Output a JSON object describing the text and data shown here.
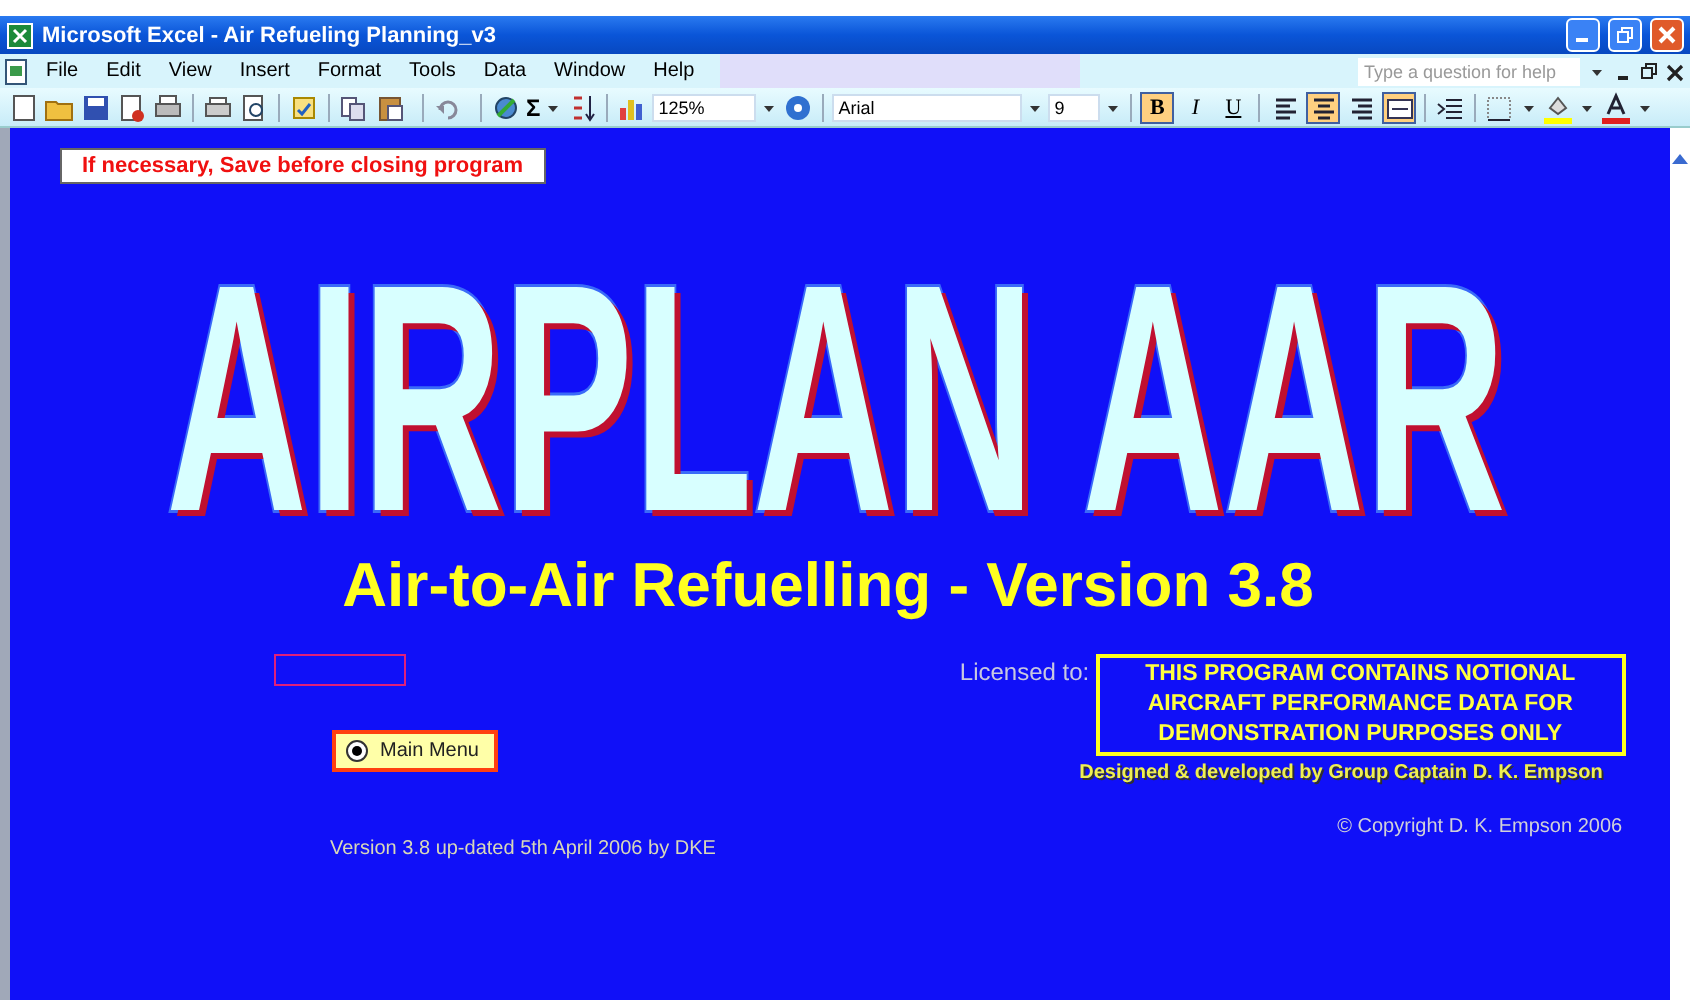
{
  "window": {
    "title": "Microsoft Excel - Air Refueling Planning_v3"
  },
  "menu": [
    "File",
    "Edit",
    "View",
    "Insert",
    "Format",
    "Tools",
    "Data",
    "Window",
    "Help"
  ],
  "help_search": {
    "placeholder": "Type a question for help"
  },
  "toolbar": {
    "autosum": "Σ",
    "zoom": "125%",
    "font": "Arial",
    "font_size": "9",
    "format_buttons": [
      {
        "label": "B",
        "on": true
      },
      {
        "label": "I",
        "on": false
      },
      {
        "label": "U",
        "on": false
      }
    ],
    "align_buttons": [
      {
        "kind": "left",
        "on": false
      },
      {
        "kind": "center",
        "on": true
      },
      {
        "kind": "right",
        "on": false
      },
      {
        "kind": "merge",
        "on": true
      }
    ]
  },
  "sheet": {
    "notice": "If necessary, Save before closing program",
    "title": "AIRPLAN AAR",
    "subtitle": "Air-to-Air Refuelling - Version 3.8",
    "licensed_label": "Licensed to:",
    "license_lines": [
      "THIS PROGRAM CONTAINS NOTIONAL",
      "AIRCRAFT PERFORMANCE DATA FOR",
      "DEMONSTRATION PURPOSES ONLY"
    ],
    "designed_by": "Designed & developed by Group Captain D. K. Empson",
    "main_menu": {
      "label": "Main Menu",
      "selected": true
    },
    "copyright": "©  Copyright D. K. Empson 2006",
    "version_note": "Version 3.8 up-dated 5th April 2006 by DKE"
  }
}
